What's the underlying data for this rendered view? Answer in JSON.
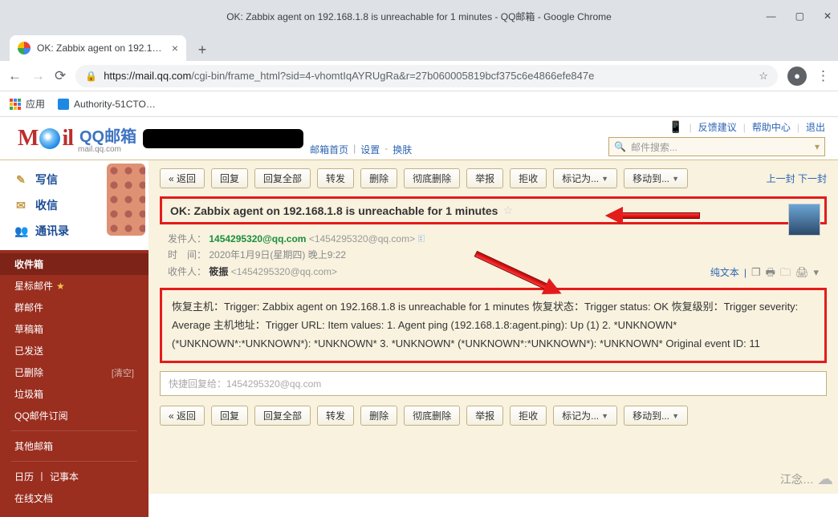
{
  "window": {
    "title": "OK: Zabbix agent on 192.168.1.8 is unreachable for 1 minutes - QQ邮箱 - Google Chrome"
  },
  "tab": {
    "title": "OK: Zabbix agent on 192.168.1.…"
  },
  "addressbar": {
    "scheme": "https://",
    "domain": "mail.qq.com",
    "path": "/cgi-bin/frame_html?sid=4-vhomtIqAYRUgRa&r=27b060005819bcf375c6e4866efe847e"
  },
  "bookmarks": {
    "apps": "应用",
    "item1": "Authority-51CTO…"
  },
  "header": {
    "brand": "QQ邮箱",
    "sub": "mail.qq.com",
    "links": {
      "home": "邮箱首页",
      "settings": "设置",
      "skin": "换肤"
    },
    "top": {
      "feedback": "反馈建议",
      "help": "帮助中心",
      "logout": "退出"
    },
    "search_placeholder": "邮件搜索..."
  },
  "sidebar": {
    "compose": "写信",
    "receive": "收信",
    "contacts": "通讯录",
    "items": [
      "收件箱",
      "星标邮件",
      "群邮件",
      "草稿箱",
      "已发送",
      "已删除",
      "垃圾箱",
      "QQ邮件订阅",
      "其他邮箱",
      "日历",
      "记事本",
      "在线文档"
    ],
    "clear": "[清空]",
    "calendar_sep": "丨"
  },
  "toolbar": {
    "back": "« 返回",
    "reply": "回复",
    "reply_all": "回复全部",
    "forward": "转发",
    "delete": "删除",
    "delete_perm": "彻底删除",
    "report": "举报",
    "reject": "拒收",
    "mark_as": "标记为...",
    "move_to": "移动到...",
    "prev_next": "上一封 下一封"
  },
  "mail": {
    "subject": "OK: Zabbix agent on 192.168.1.8 is unreachable for 1 minutes",
    "from_label": "发件人：",
    "from_addr": "1454295320@qq.com",
    "from_full": "<1454295320@qq.com>",
    "time_label": "时　间：",
    "time_value": "2020年1月9日(星期四) 晚上9:22",
    "to_label": "收件人：",
    "to_name": "筱振",
    "to_full": "<1454295320@qq.com>",
    "plain_text": "纯文本",
    "body": "恢复主机：Trigger: Zabbix agent on 192.168.1.8 is unreachable for 1 minutes 恢复状态：Trigger status: OK 恢复级别：Trigger severity: Average 主机地址：Trigger URL: Item values: 1. Agent ping (192.168.1.8:agent.ping): Up (1) 2. *UNKNOWN* (*UNKNOWN*:*UNKNOWN*): *UNKNOWN* 3. *UNKNOWN* (*UNKNOWN*:*UNKNOWN*): *UNKNOWN* Original event ID: 11",
    "quick_reply": "快捷回复给：1454295320@qq.com"
  },
  "watermark": "江念…"
}
